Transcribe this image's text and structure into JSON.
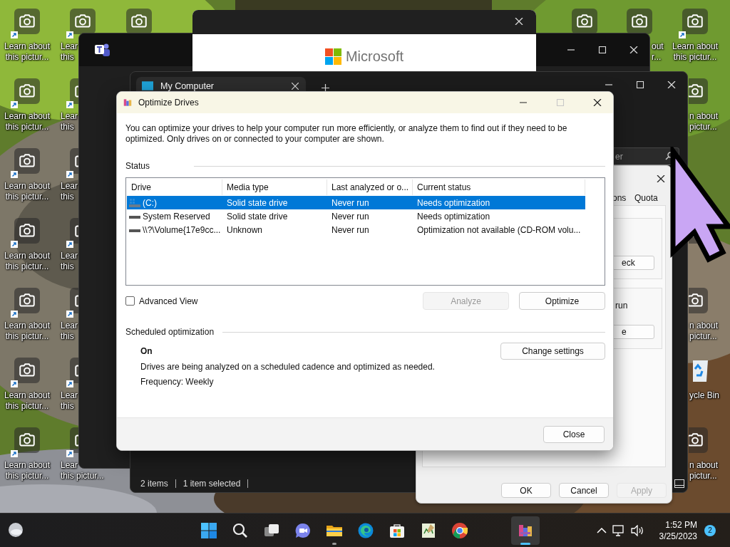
{
  "desktop_icons": [
    {
      "kind": "shortcut",
      "label_lines": [
        "Learn about",
        "this pictur..."
      ]
    },
    {
      "kind": "shortcut",
      "label_lines": [
        "Learn about",
        "this pictur..."
      ]
    },
    {
      "kind": "shortcut",
      "label_lines": [
        "Learn about",
        "this pictur..."
      ]
    },
    {
      "kind": "shortcut",
      "label_lines": [
        "Learn about",
        "this pictur..."
      ]
    },
    {
      "kind": "shortcut",
      "label_lines": [
        "Learn about",
        "this pictur..."
      ]
    },
    {
      "kind": "shortcut",
      "label_lines": [
        "Learn about",
        "this pictur..."
      ]
    },
    {
      "kind": "shortcut",
      "label_lines": [
        "Learn about",
        "this pictur..."
      ]
    },
    {
      "kind": "shortcut",
      "label_lines": [
        "Lear",
        "this"
      ]
    },
    {
      "kind": "shortcut",
      "label_lines": [
        "Lear",
        "this"
      ]
    },
    {
      "kind": "shortcut",
      "label_lines": [
        "Lear",
        "this"
      ]
    },
    {
      "kind": "shortcut",
      "label_lines": [
        "Lear",
        "this"
      ]
    },
    {
      "kind": "shortcut",
      "label_lines": [
        "Lear",
        "this"
      ]
    },
    {
      "kind": "shortcut",
      "label_lines": [
        "Lear",
        "this"
      ]
    },
    {
      "kind": "shortcut",
      "label_lines": [
        "Lear",
        "this pictur..."
      ]
    },
    {
      "kind": "plain"
    },
    {
      "kind": "plain"
    },
    {
      "kind": "plain",
      "label_lines": [
        "out",
        "r..."
      ]
    },
    {
      "kind": "shortcut",
      "label_lines": [
        "Learn about",
        "this pictur..."
      ]
    },
    {
      "kind": "plain",
      "label_lines": [
        "n about",
        "pictur..."
      ]
    },
    {
      "kind": "plain"
    },
    {
      "kind": "plain",
      "label_lines": [
        "n about",
        "pictur..."
      ]
    },
    {
      "kind": "recycle-bin",
      "label_lines": [
        "ycle Bin"
      ]
    },
    {
      "kind": "plain",
      "label_lines": [
        "n about",
        "pictur..."
      ]
    }
  ],
  "microsoft_window": {
    "brand": "Microsoft"
  },
  "explorer_window": {
    "tab": "My Computer",
    "search_placeholder": "er",
    "status_items": [
      "2 items",
      "1 item selected"
    ]
  },
  "properties_dialog": {
    "tabs": [
      "ons",
      "Quota"
    ],
    "fragments": [
      "eck",
      "run",
      "e"
    ],
    "buttons": [
      {
        "label": "OK",
        "disabled": false
      },
      {
        "label": "Cancel",
        "disabled": false
      },
      {
        "label": "Apply",
        "disabled": true
      }
    ]
  },
  "optimize_drives": {
    "title": "Optimize Drives",
    "maximize_disabled": true,
    "description": "You can optimize your drives to help your computer run more efficiently, or analyze them to find out if they need to be optimized. Only drives on or connected to your computer are shown.",
    "status_heading": "Status",
    "columns": [
      "Drive",
      "Media type",
      "Last analyzed or o...",
      "Current status"
    ],
    "drives": [
      {
        "kind": "system",
        "selected": true,
        "cells": [
          "(C:)",
          "Solid state drive",
          "Never run",
          "Needs optimization"
        ]
      },
      {
        "kind": "drive",
        "selected": false,
        "cells": [
          "System Reserved",
          "Solid state drive",
          "Never run",
          "Needs optimization"
        ]
      },
      {
        "kind": "drive",
        "selected": false,
        "cells": [
          "\\\\?\\Volume{17e9cc...",
          "Unknown",
          "Never run",
          "Optimization not available (CD-ROM volu..."
        ]
      }
    ],
    "advanced_view": {
      "label": "Advanced View",
      "checked": false
    },
    "buttons": [
      {
        "label": "Analyze",
        "disabled": true
      },
      {
        "label": "Optimize",
        "disabled": false
      }
    ],
    "scheduled_heading": "Scheduled optimization",
    "schedule_state": "On",
    "schedule_description": "Drives are being analyzed on a scheduled cadence and optimized as needed.",
    "frequency": "Frequency: Weekly",
    "change_settings": "Change settings",
    "close": "Close"
  },
  "taskbar": {
    "apps": [
      {
        "kind": "start",
        "running": false,
        "selected": false
      },
      {
        "kind": "search",
        "running": false,
        "selected": false
      },
      {
        "kind": "task-view",
        "running": false,
        "selected": false
      },
      {
        "kind": "chat",
        "running": false,
        "selected": false
      },
      {
        "kind": "folder",
        "running": true,
        "selected": false
      },
      {
        "kind": "edge",
        "running": false,
        "selected": false
      },
      {
        "kind": "store",
        "running": false,
        "selected": false
      },
      {
        "kind": "notepad",
        "running": false,
        "selected": false
      },
      {
        "kind": "chrome",
        "running": false,
        "selected": false
      },
      {
        "kind": "defrag",
        "running": true,
        "selected": true
      }
    ],
    "time": "1:52 PM",
    "date": "3/25/2023",
    "notifications": "2"
  }
}
